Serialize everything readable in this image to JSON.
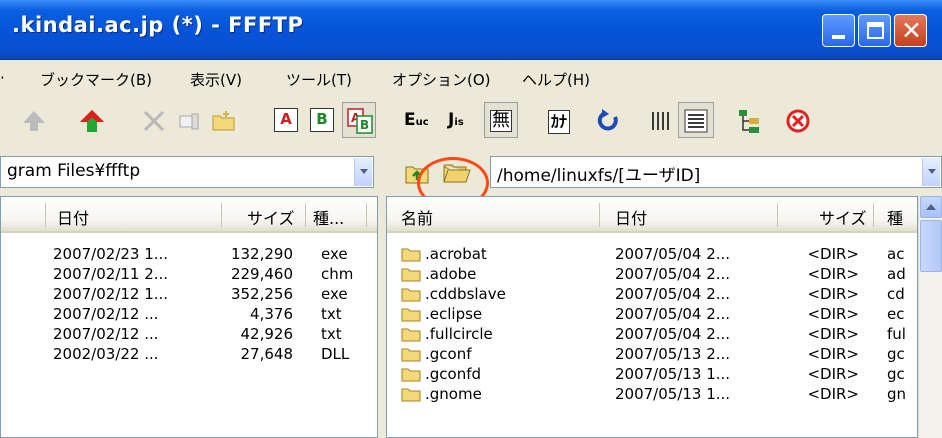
{
  "window": {
    "title": ".kindai.ac.jp (*) - FFFTP"
  },
  "menu": {
    "items": [
      "ブックマーク(B)",
      "表示(V)",
      "ツール(T)",
      "オプション(O)",
      "ヘルプ(H)"
    ]
  },
  "toolbar": {
    "mode_buttons": [
      "A",
      "B"
    ],
    "euc_label": "E",
    "jis_label": "J",
    "muhenkan_label": "無",
    "kana_label": "ｶﾅ"
  },
  "local": {
    "path": "gram Files¥ffftp",
    "columns": [
      "日付",
      "サイズ",
      "種..."
    ],
    "rows": [
      {
        "date": "2007/02/23 1...",
        "size": "132,290",
        "type": "exe"
      },
      {
        "date": "2007/02/11 2...",
        "size": "229,460",
        "type": "chm"
      },
      {
        "date": "2007/02/12 1...",
        "size": "352,256",
        "type": "exe"
      },
      {
        "date": "2007/02/12  ...",
        "size": "4,376",
        "type": "txt"
      },
      {
        "date": "2007/02/12  ...",
        "size": "42,926",
        "type": "txt"
      },
      {
        "date": "2002/03/22  ...",
        "size": "27,648",
        "type": "DLL"
      }
    ]
  },
  "remote": {
    "path": "/home/linuxfs/[ユーザID]",
    "columns": [
      "名前",
      "日付",
      "サイズ",
      "種"
    ],
    "rows": [
      {
        "name": ".acrobat",
        "date": "2007/05/04 2...",
        "size": "<DIR>",
        "type": "ac"
      },
      {
        "name": ".adobe",
        "date": "2007/05/04 2...",
        "size": "<DIR>",
        "type": "ad"
      },
      {
        "name": ".cddbslave",
        "date": "2007/05/04 2...",
        "size": "<DIR>",
        "type": "cd"
      },
      {
        "name": ".eclipse",
        "date": "2007/05/04 2...",
        "size": "<DIR>",
        "type": "ec"
      },
      {
        "name": ".fullcircle",
        "date": "2007/05/04 2...",
        "size": "<DIR>",
        "type": "ful"
      },
      {
        "name": ".gconf",
        "date": "2007/05/13 2...",
        "size": "<DIR>",
        "type": "gc"
      },
      {
        "name": ".gconfd",
        "date": "2007/05/13 1...",
        "size": "<DIR>",
        "type": "gc"
      },
      {
        "name": ".gnome",
        "date": "2007/05/13 1...",
        "size": "<DIR>",
        "type": "gn"
      }
    ]
  },
  "colors": {
    "titlebar": "#0653d8",
    "annotation_circle": "#ff4a14"
  }
}
